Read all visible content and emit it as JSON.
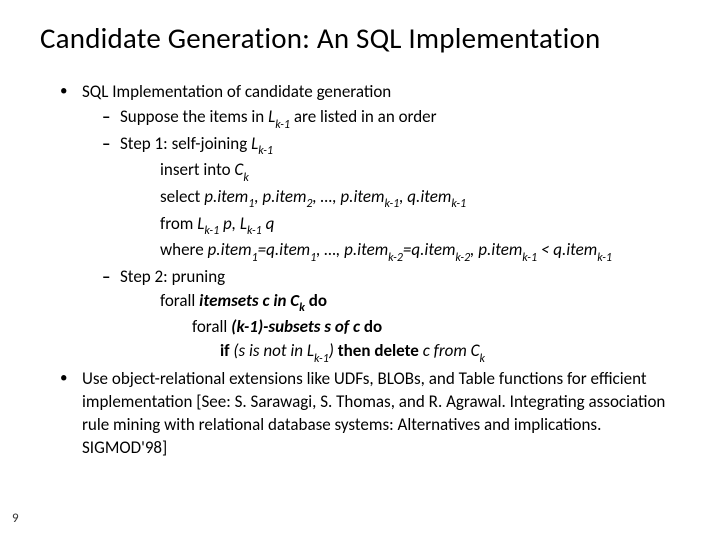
{
  "title": "Candidate Generation: An SQL Implementation",
  "b1": {
    "head": "SQL Implementation of candidate generation",
    "d1": {
      "prefix": "Suppose the items in ",
      "sym": "L",
      "sub": "k-1",
      "suffix": " are listed in an order"
    },
    "d2": {
      "prefix": "Step 1: self-joining ",
      "sym": "L",
      "sub": "k-1"
    },
    "step1": {
      "l1a": "insert into ",
      "l1b": "C",
      "l1b_sub": "k",
      "l2a": "select ",
      "l2b": "p.item",
      "l2_s1": "1",
      "l2c": ", p.item",
      "l2_s2": "2",
      "l2d": ", …, p.item",
      "l2_sk1": "k-1",
      "l2e": ", q.item",
      "l2_sk1b": "k-1",
      "l3a": "from ",
      "l3b": "L",
      "l3_s1": "k-1",
      "l3c": " p, L",
      "l3_s2": "k-1",
      "l3d": " q",
      "l4a": "where ",
      "l4b": "p.item",
      "l4_s1": "1",
      "l4c": "=q.item",
      "l4_s1b": "1",
      "l4d": ", …, p.item",
      "l4_sk2": "k-2",
      "l4e": "=q.item",
      "l4_sk2b": "k-2",
      "l4f": ", p.item",
      "l4_sk1": "k-1",
      "l4g": " < q.item",
      "l4_sk1b": "k-1"
    },
    "d3": "Step 2: pruning",
    "step2": {
      "l1a": "forall ",
      "l1b": "itemsets c in C",
      "l1b_sub": "k",
      "l1c": " do",
      "l2a": "forall ",
      "l2b": "(k-1)-subsets s of c",
      "l2c": " do",
      "l3a": "if ",
      "l3b": "(s is not in L",
      "l3b_sub": "k-1",
      "l3c": ") ",
      "l3d": "then delete ",
      "l3e": "c from C",
      "l3e_sub": "k"
    }
  },
  "b2": {
    "t1": "Use object-relational extensions like UDFs, BLOBs, and Table functions for efficient implementation [See: S. Sarawagi, S. Thomas, and R. Agrawal. ",
    "t2": "Integrating association rule mining with relational database systems: Alternatives and implications. ",
    "t3": "SIGMOD'98]"
  },
  "pagenum": "9"
}
